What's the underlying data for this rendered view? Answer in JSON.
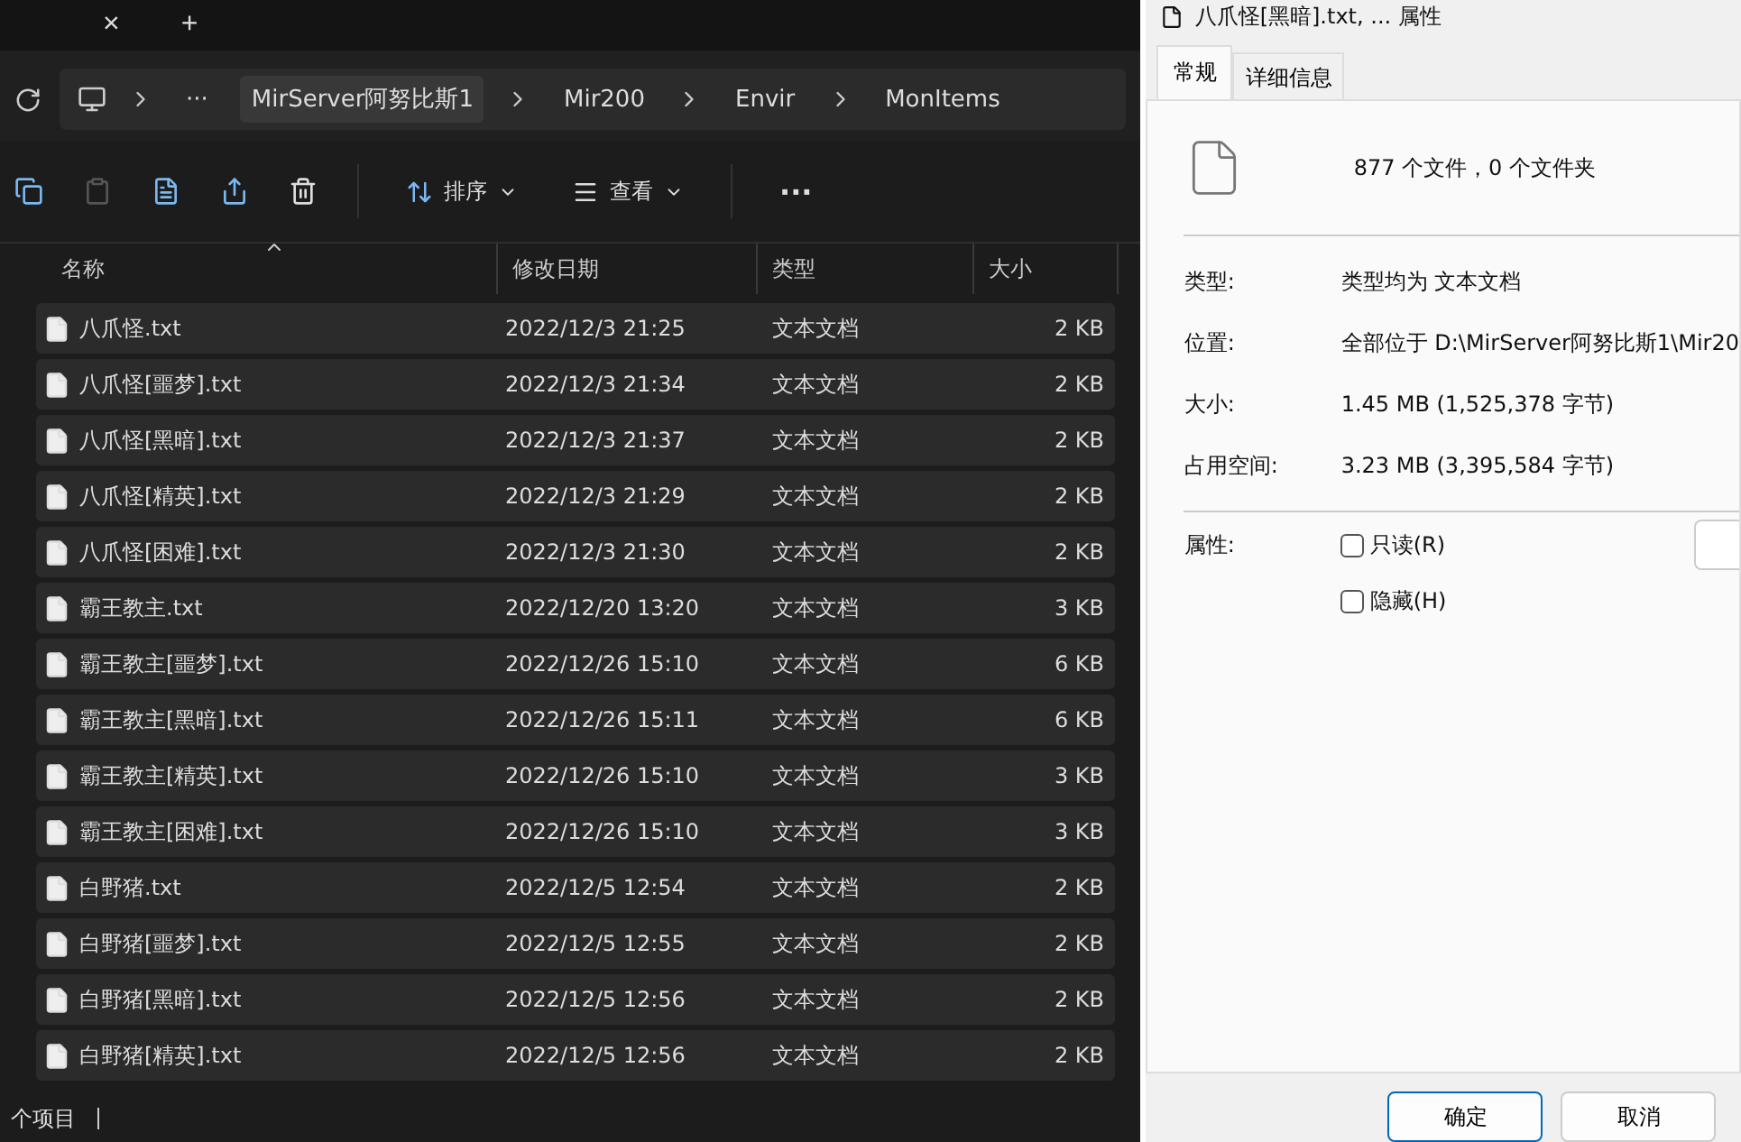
{
  "explorer": {
    "tab_close": "×",
    "new_tab": "+",
    "breadcrumb": [
      "MirServer阿努比斯1",
      "Mir200",
      "Envir",
      "MonItems"
    ],
    "breadcrumb_more": "···",
    "toolbar": {
      "sort": "排序",
      "view": "查看",
      "more": "···"
    },
    "columns": [
      "名称",
      "修改日期",
      "类型",
      "大小"
    ],
    "rows": [
      {
        "name": "八爪怪.txt",
        "date": "2022/12/3 21:25",
        "type": "文本文档",
        "size": "2 KB"
      },
      {
        "name": "八爪怪[噩梦].txt",
        "date": "2022/12/3 21:34",
        "type": "文本文档",
        "size": "2 KB"
      },
      {
        "name": "八爪怪[黑暗].txt",
        "date": "2022/12/3 21:37",
        "type": "文本文档",
        "size": "2 KB"
      },
      {
        "name": "八爪怪[精英].txt",
        "date": "2022/12/3 21:29",
        "type": "文本文档",
        "size": "2 KB"
      },
      {
        "name": "八爪怪[困难].txt",
        "date": "2022/12/3 21:30",
        "type": "文本文档",
        "size": "2 KB"
      },
      {
        "name": "霸王教主.txt",
        "date": "2022/12/20 13:20",
        "type": "文本文档",
        "size": "3 KB"
      },
      {
        "name": "霸王教主[噩梦].txt",
        "date": "2022/12/26 15:10",
        "type": "文本文档",
        "size": "6 KB"
      },
      {
        "name": "霸王教主[黑暗].txt",
        "date": "2022/12/26 15:11",
        "type": "文本文档",
        "size": "6 KB"
      },
      {
        "name": "霸王教主[精英].txt",
        "date": "2022/12/26 15:10",
        "type": "文本文档",
        "size": "3 KB"
      },
      {
        "name": "霸王教主[困难].txt",
        "date": "2022/12/26 15:10",
        "type": "文本文档",
        "size": "3 KB"
      },
      {
        "name": "白野猪.txt",
        "date": "2022/12/5 12:54",
        "type": "文本文档",
        "size": "2 KB"
      },
      {
        "name": "白野猪[噩梦].txt",
        "date": "2022/12/5 12:55",
        "type": "文本文档",
        "size": "2 KB"
      },
      {
        "name": "白野猪[黑暗].txt",
        "date": "2022/12/5 12:56",
        "type": "文本文档",
        "size": "2 KB"
      },
      {
        "name": "白野猪[精英].txt",
        "date": "2022/12/5 12:56",
        "type": "文本文档",
        "size": "2 KB"
      }
    ],
    "status": "个项目"
  },
  "dialog": {
    "title": "八爪怪[黑暗].txt, ... 属性",
    "tabs": [
      {
        "label": "常规",
        "selected": true
      },
      {
        "label": "详细信息",
        "selected": false
      }
    ],
    "summary": "877 个文件，0 个文件夹",
    "fields": [
      {
        "label": "类型:",
        "value": "类型均为 文本文档"
      },
      {
        "label": "位置:",
        "value": "全部位于 D:\\MirServer阿努比斯1\\Mir20"
      },
      {
        "label": "大小:",
        "value": "1.45 MB (1,525,378 字节)"
      },
      {
        "label": "占用空间:",
        "value": "3.23 MB (3,395,584 字节)"
      }
    ],
    "attributes_label": "属性:",
    "attributes": [
      {
        "label": "只读(R)",
        "checked": false
      },
      {
        "label": "隐藏(H)",
        "checked": false
      }
    ],
    "buttons": [
      {
        "label": "确定",
        "selected": true
      },
      {
        "label": "取消",
        "selected": false
      }
    ]
  }
}
